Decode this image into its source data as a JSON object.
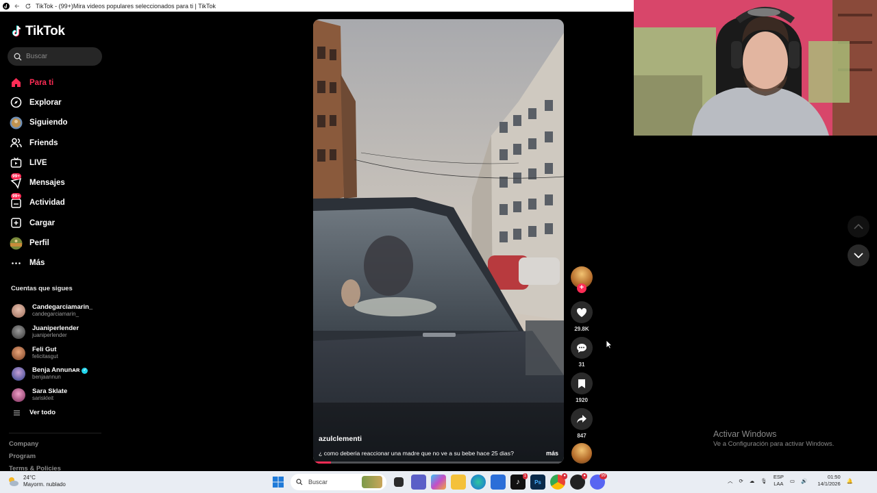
{
  "browser": {
    "title": "TikTok - (99+)Mira videos populares seleccionados para ti | TikTok"
  },
  "sidebar": {
    "logo": "TikTok",
    "search_placeholder": "Buscar",
    "nav": [
      {
        "label": "Para ti",
        "icon": "home-icon",
        "active": true
      },
      {
        "label": "Explorar",
        "icon": "compass-icon"
      },
      {
        "label": "Siguiendo",
        "icon": "following-avatar-icon"
      },
      {
        "label": "Friends",
        "icon": "friends-icon"
      },
      {
        "label": "LIVE",
        "icon": "live-icon"
      },
      {
        "label": "Mensajes",
        "icon": "messages-icon",
        "badge": "99+"
      },
      {
        "label": "Actividad",
        "icon": "activity-icon",
        "badge": "99+"
      },
      {
        "label": "Cargar",
        "icon": "upload-icon"
      },
      {
        "label": "Perfil",
        "icon": "profile-avatar-icon"
      },
      {
        "label": "Más",
        "icon": "more-icon"
      }
    ],
    "following_title": "Cuentas que sigues",
    "following": [
      {
        "name": "Candegarciamarin_",
        "handle": "candegarciamarin_",
        "color": "#c9a08a"
      },
      {
        "name": "Juaniperlender",
        "handle": "juaniperlender",
        "color": "#6b6b6b"
      },
      {
        "name": "Feli Gut",
        "handle": "felicitasgut",
        "color": "#c77b4f"
      },
      {
        "name": "Benja Annunᴀʀ",
        "handle": "benjaannun",
        "color": "#5a6fb0",
        "verified": true
      },
      {
        "name": "Sara Sklate",
        "handle": "sariskleit",
        "color": "#d06aa0"
      }
    ],
    "see_all": "Ver todo",
    "footer": [
      "Company",
      "Program",
      "Terms & Policies"
    ]
  },
  "video": {
    "username": "azulclementi",
    "description": "¿ como deberia reaccionar una madre que no ve a su bebe hace 25 dias?",
    "more": "más",
    "progress": 0.07
  },
  "actions": {
    "likes": "29.8K",
    "comments": "31",
    "saves": "1920",
    "shares": "847"
  },
  "watermark": {
    "title": "Activar Windows",
    "subtitle": "Ve a Configuración para activar Windows."
  },
  "taskbar": {
    "temperature": "24°C",
    "weather": "Mayorm. nublado",
    "search_placeholder": "Buscar",
    "lang1": "ESP",
    "lang2": "LAA",
    "time": "01:50",
    "date": "14/1/2026",
    "tiktok_badge": "1",
    "discord_badge": "99"
  },
  "colors": {
    "accent": "#fe2c55",
    "background": "#000000"
  }
}
